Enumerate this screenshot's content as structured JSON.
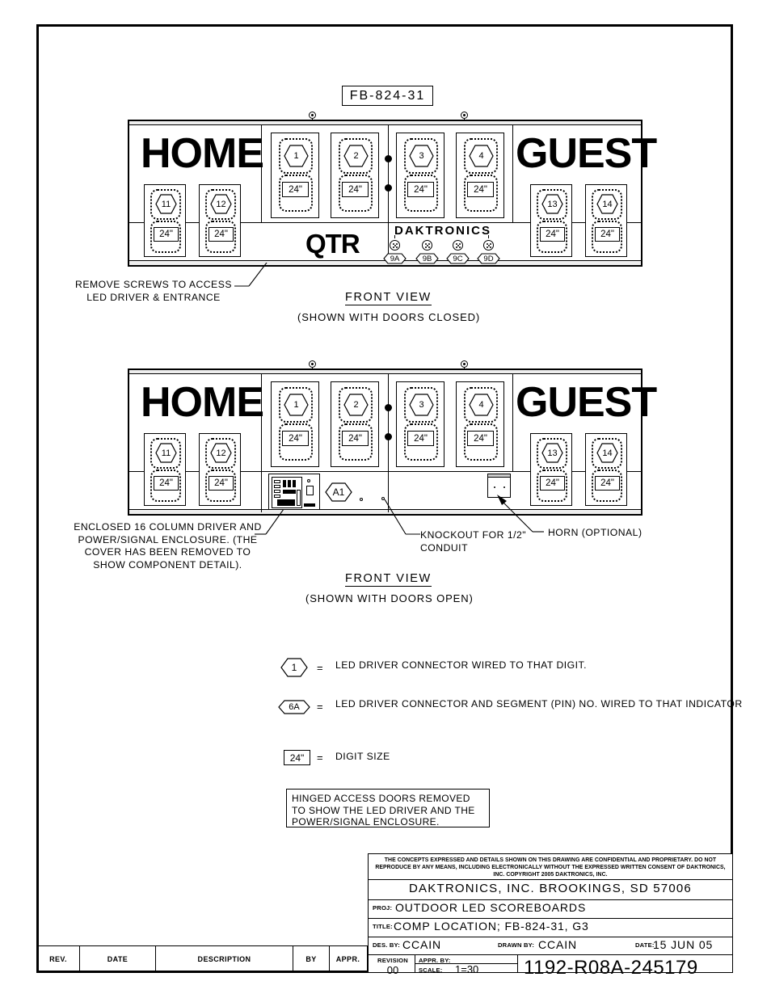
{
  "drawing": {
    "part_tag": "FB-824-31",
    "views": [
      {
        "caption": "FRONT VIEW",
        "subcaption": "(SHOWN WITH DOORS CLOSED)"
      },
      {
        "caption": "FRONT VIEW",
        "subcaption": "(SHOWN WITH DOORS OPEN)"
      }
    ],
    "board": {
      "home_label": "HOME",
      "guest_label": "GUEST",
      "qtr_label": "QTR",
      "brand_label": "DAKTRONICS",
      "digit_size": "24\"",
      "home_digits": [
        "11",
        "12"
      ],
      "score_digits_left": [
        "1",
        "2"
      ],
      "score_digits_right": [
        "3",
        "4"
      ],
      "guest_digits": [
        "13",
        "14"
      ],
      "indicators": [
        "9A",
        "9B",
        "9C",
        "9D"
      ],
      "driver_tag": "A1"
    },
    "annotations": {
      "remove_screws": "REMOVE SCREWS TO ACCESS\nLED DRIVER & ENTRANCE",
      "enclosure": "ENCLOSED 16 COLUMN DRIVER\nAND POWER/SIGNAL ENCLOSURE.\n(THE COVER HAS BEEN REMOVED\nTO SHOW COMPONENT DETAIL).",
      "knockout": "KNOCKOUT FOR\n1/2\" CONDUIT",
      "horn": "HORN (OPTIONAL)"
    },
    "legend": {
      "equals": "=",
      "items": [
        {
          "symbol": "1",
          "shape": "hex",
          "text": "LED DRIVER CONNECTOR\nWIRED TO THAT DIGIT."
        },
        {
          "symbol": "6A",
          "shape": "hexw",
          "text": "LED DRIVER CONNECTOR\nAND SEGMENT (PIN) NO.\nWIRED TO THAT INDICATOR"
        },
        {
          "symbol": "24\"",
          "shape": "box",
          "text": "DIGIT SIZE"
        }
      ]
    },
    "note_box": "HINGED ACCESS DOORS REMOVED\nTO SHOW THE LED DRIVER AND\nTHE POWER/SIGNAL ENCLOSURE."
  },
  "title_block": {
    "copyright": "THE CONCEPTS  EXPRESSED  AND   DETAILS SHOWN ON THIS DRAWING ARE CONFIDENTIAL AND\nPROPRIETARY.   DO NOT REPRODUCE BY ANY MEANS, INCLUDING ELECTRONICALLY WITHOUT THE\nEXPRESSED WRITTEN CONSENT OF DAKTRONICS, INC.          COPYRIGHT 2005 DAKTRONICS, INC.",
    "company": "DAKTRONICS, INC.   BROOKINGS, SD 57006",
    "proj_label": "PROJ:",
    "proj_value": "OUTDOOR LED SCOREBOARDS",
    "title_label": "TITLE:",
    "title_value": "COMP LOCATION; FB-824-31, G3",
    "des_by_label": "DES. BY:",
    "des_by_value": "CCAIN",
    "drawn_by_label": "DRAWN BY:",
    "drawn_by_value": "CCAIN",
    "date_label": "DATE:",
    "date_value": "15 JUN 05",
    "revision_label": "REVISION",
    "revision_value": "00",
    "appr_by_label": "APPR. BY:",
    "appr_by_value": "",
    "scale_label": "SCALE:",
    "scale_value": "1=30",
    "drawing_number": "1192-R08A-245179"
  },
  "revision_table": {
    "headers": [
      "REV.",
      "DATE",
      "DESCRIPTION",
      "BY",
      "APPR."
    ]
  }
}
